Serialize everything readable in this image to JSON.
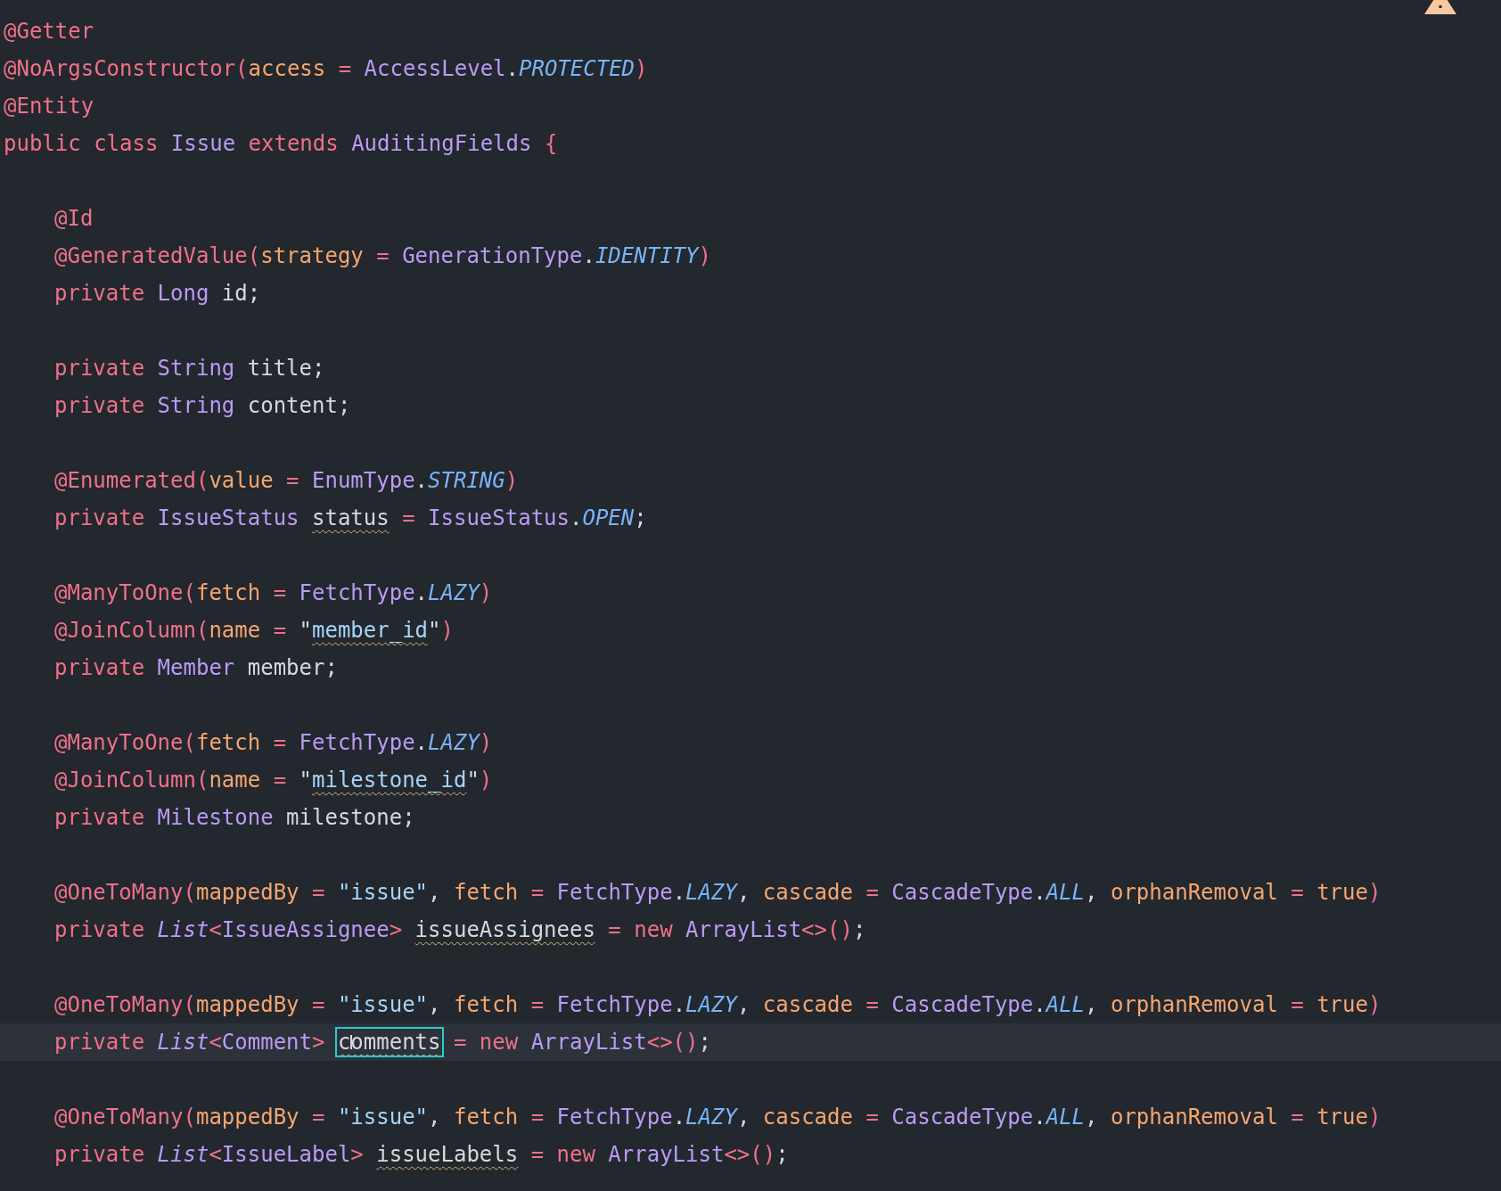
{
  "editor": {
    "warning_indicator": true,
    "lines": [
      {
        "kind": "code",
        "indent": false,
        "current": false,
        "tokens": [
          {
            "text": "@Getter",
            "kind": "annotation"
          }
        ]
      },
      {
        "kind": "code",
        "indent": false,
        "current": false,
        "tokens": [
          {
            "text": "@NoArgsConstructor(",
            "kind": "annotation"
          },
          {
            "text": "access",
            "kind": "parameter"
          },
          {
            "text": " = ",
            "kind": "operator"
          },
          {
            "text": "AccessLevel",
            "kind": "type"
          },
          {
            "text": ".",
            "kind": "plain"
          },
          {
            "text": "PROTECTED",
            "kind": "constant"
          },
          {
            "text": ")",
            "kind": "operator"
          }
        ]
      },
      {
        "kind": "code",
        "indent": false,
        "current": false,
        "tokens": [
          {
            "text": "@Entity",
            "kind": "annotation"
          }
        ]
      },
      {
        "kind": "code",
        "indent": false,
        "current": false,
        "tokens": [
          {
            "text": "public class ",
            "kind": "keyword"
          },
          {
            "text": "Issue",
            "kind": "type"
          },
          {
            "text": " extends ",
            "kind": "keyword"
          },
          {
            "text": "AuditingFields",
            "kind": "type"
          },
          {
            "text": " {",
            "kind": "operator"
          }
        ]
      },
      {
        "kind": "blank"
      },
      {
        "kind": "code",
        "indent": true,
        "current": false,
        "tokens": [
          {
            "text": "@Id",
            "kind": "annotation"
          }
        ]
      },
      {
        "kind": "code",
        "indent": true,
        "current": false,
        "tokens": [
          {
            "text": "@GeneratedValue(",
            "kind": "annotation"
          },
          {
            "text": "strategy",
            "kind": "parameter"
          },
          {
            "text": " = ",
            "kind": "operator"
          },
          {
            "text": "GenerationType",
            "kind": "type"
          },
          {
            "text": ".",
            "kind": "plain"
          },
          {
            "text": "IDENTITY",
            "kind": "constant"
          },
          {
            "text": ")",
            "kind": "operator"
          }
        ]
      },
      {
        "kind": "code",
        "indent": true,
        "current": false,
        "tokens": [
          {
            "text": "private ",
            "kind": "keyword"
          },
          {
            "text": "Long",
            "kind": "type"
          },
          {
            "text": " id;",
            "kind": "plain"
          }
        ]
      },
      {
        "kind": "blank"
      },
      {
        "kind": "code",
        "indent": true,
        "current": false,
        "tokens": [
          {
            "text": "private ",
            "kind": "keyword"
          },
          {
            "text": "String",
            "kind": "type"
          },
          {
            "text": " title;",
            "kind": "plain"
          }
        ]
      },
      {
        "kind": "code",
        "indent": true,
        "current": false,
        "tokens": [
          {
            "text": "private ",
            "kind": "keyword"
          },
          {
            "text": "String",
            "kind": "type"
          },
          {
            "text": " content;",
            "kind": "plain"
          }
        ]
      },
      {
        "kind": "blank"
      },
      {
        "kind": "code",
        "indent": true,
        "current": false,
        "tokens": [
          {
            "text": "@Enumerated(",
            "kind": "annotation"
          },
          {
            "text": "value",
            "kind": "parameter"
          },
          {
            "text": " = ",
            "kind": "operator"
          },
          {
            "text": "EnumType",
            "kind": "type"
          },
          {
            "text": ".",
            "kind": "plain"
          },
          {
            "text": "STRING",
            "kind": "constant"
          },
          {
            "text": ")",
            "kind": "operator"
          }
        ]
      },
      {
        "kind": "code",
        "indent": true,
        "current": false,
        "tokens": [
          {
            "text": "private ",
            "kind": "keyword"
          },
          {
            "text": "IssueStatus ",
            "kind": "type"
          },
          {
            "text": "status",
            "kind": "plain",
            "warning": true
          },
          {
            "text": " = ",
            "kind": "operator"
          },
          {
            "text": "IssueStatus",
            "kind": "type"
          },
          {
            "text": ".",
            "kind": "plain"
          },
          {
            "text": "OPEN",
            "kind": "constant"
          },
          {
            "text": ";",
            "kind": "plain"
          }
        ]
      },
      {
        "kind": "blank"
      },
      {
        "kind": "code",
        "indent": true,
        "current": false,
        "tokens": [
          {
            "text": "@ManyToOne(",
            "kind": "annotation"
          },
          {
            "text": "fetch",
            "kind": "parameter"
          },
          {
            "text": " = ",
            "kind": "operator"
          },
          {
            "text": "FetchType",
            "kind": "type"
          },
          {
            "text": ".",
            "kind": "plain"
          },
          {
            "text": "LAZY",
            "kind": "constant"
          },
          {
            "text": ")",
            "kind": "operator"
          }
        ]
      },
      {
        "kind": "code",
        "indent": true,
        "current": false,
        "tokens": [
          {
            "text": "@JoinColumn(",
            "kind": "annotation"
          },
          {
            "text": "name",
            "kind": "parameter"
          },
          {
            "text": " = ",
            "kind": "operator"
          },
          {
            "text": "\"",
            "kind": "plain"
          },
          {
            "text": "member_id",
            "kind": "string",
            "warning": true
          },
          {
            "text": "\"",
            "kind": "plain"
          },
          {
            "text": ")",
            "kind": "operator"
          }
        ]
      },
      {
        "kind": "code",
        "indent": true,
        "current": false,
        "tokens": [
          {
            "text": "private ",
            "kind": "keyword"
          },
          {
            "text": "Member",
            "kind": "type"
          },
          {
            "text": " member;",
            "kind": "plain"
          }
        ]
      },
      {
        "kind": "blank"
      },
      {
        "kind": "code",
        "indent": true,
        "current": false,
        "tokens": [
          {
            "text": "@ManyToOne(",
            "kind": "annotation"
          },
          {
            "text": "fetch",
            "kind": "parameter"
          },
          {
            "text": " = ",
            "kind": "operator"
          },
          {
            "text": "FetchType",
            "kind": "type"
          },
          {
            "text": ".",
            "kind": "plain"
          },
          {
            "text": "LAZY",
            "kind": "constant"
          },
          {
            "text": ")",
            "kind": "operator"
          }
        ]
      },
      {
        "kind": "code",
        "indent": true,
        "current": false,
        "tokens": [
          {
            "text": "@JoinColumn(",
            "kind": "annotation"
          },
          {
            "text": "name",
            "kind": "parameter"
          },
          {
            "text": " = ",
            "kind": "operator"
          },
          {
            "text": "\"",
            "kind": "plain"
          },
          {
            "text": "milestone_id",
            "kind": "string",
            "warning": true
          },
          {
            "text": "\"",
            "kind": "plain"
          },
          {
            "text": ")",
            "kind": "operator"
          }
        ]
      },
      {
        "kind": "code",
        "indent": true,
        "current": false,
        "tokens": [
          {
            "text": "private ",
            "kind": "keyword"
          },
          {
            "text": "Milestone",
            "kind": "type"
          },
          {
            "text": " milestone;",
            "kind": "plain"
          }
        ]
      },
      {
        "kind": "blank"
      },
      {
        "kind": "code",
        "indent": true,
        "current": false,
        "tokens": [
          {
            "text": "@OneToMany(",
            "kind": "annotation"
          },
          {
            "text": "mappedBy",
            "kind": "parameter"
          },
          {
            "text": " = ",
            "kind": "operator"
          },
          {
            "text": "\"issue\"",
            "kind": "string"
          },
          {
            "text": ", ",
            "kind": "plain"
          },
          {
            "text": "fetch",
            "kind": "parameter"
          },
          {
            "text": " = ",
            "kind": "operator"
          },
          {
            "text": "FetchType",
            "kind": "type"
          },
          {
            "text": ".",
            "kind": "plain"
          },
          {
            "text": "LAZY",
            "kind": "constant"
          },
          {
            "text": ", ",
            "kind": "plain"
          },
          {
            "text": "cascade",
            "kind": "parameter"
          },
          {
            "text": " = ",
            "kind": "operator"
          },
          {
            "text": "CascadeType",
            "kind": "type"
          },
          {
            "text": ".",
            "kind": "plain"
          },
          {
            "text": "ALL",
            "kind": "constant"
          },
          {
            "text": ", ",
            "kind": "plain"
          },
          {
            "text": "orphanRemoval",
            "kind": "parameter"
          },
          {
            "text": " = ",
            "kind": "operator"
          },
          {
            "text": "true",
            "kind": "parameter"
          },
          {
            "text": ")",
            "kind": "operator"
          }
        ]
      },
      {
        "kind": "code",
        "indent": true,
        "current": false,
        "tokens": [
          {
            "text": "private ",
            "kind": "keyword"
          },
          {
            "text": "List",
            "kind": "interface"
          },
          {
            "text": "<",
            "kind": "operator"
          },
          {
            "text": "IssueAssignee",
            "kind": "type"
          },
          {
            "text": "> ",
            "kind": "operator"
          },
          {
            "text": "issueAssignees",
            "kind": "plain",
            "warning": true
          },
          {
            "text": " = new ",
            "kind": "keyword"
          },
          {
            "text": "ArrayList",
            "kind": "type"
          },
          {
            "text": "<>()",
            "kind": "operator"
          },
          {
            "text": ";",
            "kind": "plain"
          }
        ]
      },
      {
        "kind": "blank"
      },
      {
        "kind": "code",
        "indent": true,
        "current": false,
        "tokens": [
          {
            "text": "@OneToMany(",
            "kind": "annotation"
          },
          {
            "text": "mappedBy",
            "kind": "parameter"
          },
          {
            "text": " = ",
            "kind": "operator"
          },
          {
            "text": "\"issue\"",
            "kind": "string"
          },
          {
            "text": ", ",
            "kind": "plain"
          },
          {
            "text": "fetch",
            "kind": "parameter"
          },
          {
            "text": " = ",
            "kind": "operator"
          },
          {
            "text": "FetchType",
            "kind": "type"
          },
          {
            "text": ".",
            "kind": "plain"
          },
          {
            "text": "LAZY",
            "kind": "constant"
          },
          {
            "text": ", ",
            "kind": "plain"
          },
          {
            "text": "cascade",
            "kind": "parameter"
          },
          {
            "text": " = ",
            "kind": "operator"
          },
          {
            "text": "CascadeType",
            "kind": "type"
          },
          {
            "text": ".",
            "kind": "plain"
          },
          {
            "text": "ALL",
            "kind": "constant"
          },
          {
            "text": ", ",
            "kind": "plain"
          },
          {
            "text": "orphanRemoval",
            "kind": "parameter"
          },
          {
            "text": " = ",
            "kind": "operator"
          },
          {
            "text": "true",
            "kind": "parameter"
          },
          {
            "text": ")",
            "kind": "operator"
          }
        ]
      },
      {
        "kind": "code",
        "indent": true,
        "current": true,
        "tokens": [
          {
            "text": "private ",
            "kind": "keyword"
          },
          {
            "text": "List",
            "kind": "interface"
          },
          {
            "text": "<",
            "kind": "operator"
          },
          {
            "text": "Comment",
            "kind": "type"
          },
          {
            "text": "> ",
            "kind": "operator"
          },
          {
            "text": "comments",
            "kind": "plain",
            "warning": true,
            "highlighted": true,
            "cursor": true
          },
          {
            "text": " = new ",
            "kind": "keyword"
          },
          {
            "text": "ArrayList",
            "kind": "type"
          },
          {
            "text": "<>()",
            "kind": "operator"
          },
          {
            "text": ";",
            "kind": "plain"
          }
        ]
      },
      {
        "kind": "blank"
      },
      {
        "kind": "code",
        "indent": true,
        "current": false,
        "tokens": [
          {
            "text": "@OneToMany(",
            "kind": "annotation"
          },
          {
            "text": "mappedBy",
            "kind": "parameter"
          },
          {
            "text": " = ",
            "kind": "operator"
          },
          {
            "text": "\"issue\"",
            "kind": "string"
          },
          {
            "text": ", ",
            "kind": "plain"
          },
          {
            "text": "fetch",
            "kind": "parameter"
          },
          {
            "text": " = ",
            "kind": "operator"
          },
          {
            "text": "FetchType",
            "kind": "type"
          },
          {
            "text": ".",
            "kind": "plain"
          },
          {
            "text": "LAZY",
            "kind": "constant"
          },
          {
            "text": ", ",
            "kind": "plain"
          },
          {
            "text": "cascade",
            "kind": "parameter"
          },
          {
            "text": " = ",
            "kind": "operator"
          },
          {
            "text": "CascadeType",
            "kind": "type"
          },
          {
            "text": ".",
            "kind": "plain"
          },
          {
            "text": "ALL",
            "kind": "constant"
          },
          {
            "text": ", ",
            "kind": "plain"
          },
          {
            "text": "orphanRemoval",
            "kind": "parameter"
          },
          {
            "text": " = ",
            "kind": "operator"
          },
          {
            "text": "true",
            "kind": "parameter"
          },
          {
            "text": ")",
            "kind": "operator"
          }
        ]
      },
      {
        "kind": "code",
        "indent": true,
        "current": false,
        "tokens": [
          {
            "text": "private ",
            "kind": "keyword"
          },
          {
            "text": "List",
            "kind": "interface"
          },
          {
            "text": "<",
            "kind": "operator"
          },
          {
            "text": "IssueLabel",
            "kind": "type"
          },
          {
            "text": "> ",
            "kind": "operator"
          },
          {
            "text": "issueLabels",
            "kind": "plain",
            "warning": true
          },
          {
            "text": " = new ",
            "kind": "keyword"
          },
          {
            "text": "ArrayList",
            "kind": "type"
          },
          {
            "text": "<>()",
            "kind": "operator"
          },
          {
            "text": ";",
            "kind": "plain"
          }
        ]
      }
    ]
  }
}
